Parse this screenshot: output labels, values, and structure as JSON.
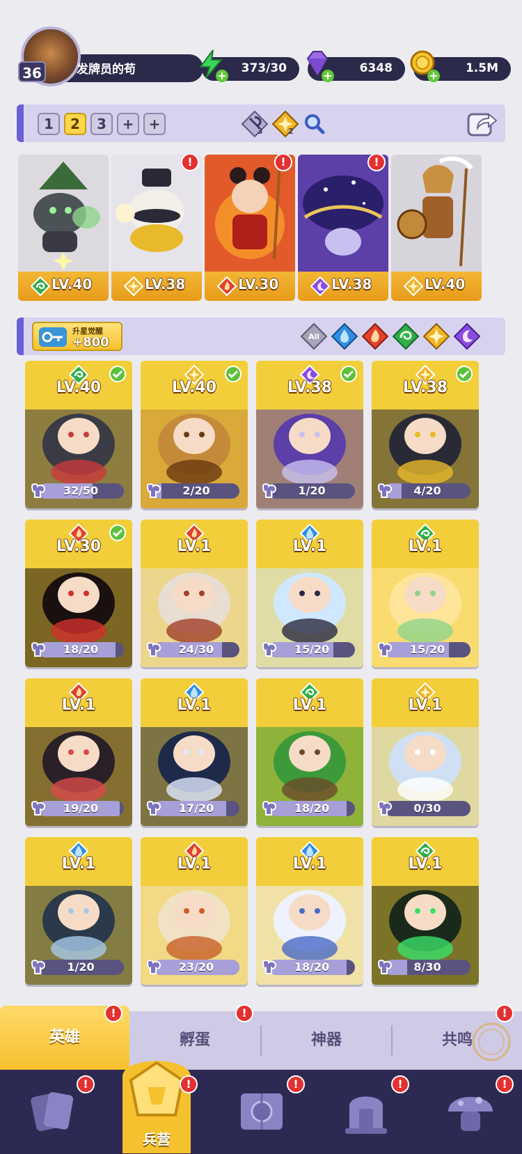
{
  "player": {
    "level": "36",
    "name": "发牌员的苟"
  },
  "resources": [
    {
      "icon": "energy-bolt-icon",
      "value": "373/30"
    },
    {
      "icon": "purple-gem-icon",
      "value": "6348"
    },
    {
      "icon": "gold-coin-icon",
      "value": "1.5M"
    }
  ],
  "team_bar": {
    "slots": [
      "1",
      "2",
      "3",
      "+",
      "+"
    ],
    "active_slot": "2",
    "icon_counts": [
      "3",
      "2"
    ]
  },
  "team_heroes": [
    {
      "level": "LV.40",
      "element": "nature",
      "badge": ""
    },
    {
      "level": "LV.38",
      "element": "light",
      "badge": "!"
    },
    {
      "level": "LV.30",
      "element": "fire",
      "badge": "!"
    },
    {
      "level": "LV.38",
      "element": "dark",
      "badge": "!"
    },
    {
      "level": "LV.40",
      "element": "light",
      "badge": ""
    }
  ],
  "filter_bar": {
    "awaken_label": "升星觉醒",
    "awaken_value": "+800",
    "filters": [
      "All",
      "water",
      "fire",
      "nature",
      "light",
      "dark"
    ]
  },
  "heroes": [
    {
      "level": "LV.40",
      "element": "nature",
      "progress": "32/50",
      "fill": 0.64,
      "check": true
    },
    {
      "level": "LV.40",
      "element": "light",
      "progress": "2/20",
      "fill": 0.1,
      "check": true
    },
    {
      "level": "LV.38",
      "element": "dark",
      "progress": "1/20",
      "fill": 0.05,
      "check": true
    },
    {
      "level": "LV.38",
      "element": "light",
      "progress": "4/20",
      "fill": 0.2,
      "check": true
    },
    {
      "level": "LV.30",
      "element": "fire",
      "progress": "18/20",
      "fill": 0.9,
      "check": true
    },
    {
      "level": "LV.1",
      "element": "fire",
      "progress": "24/30",
      "fill": 0.8,
      "check": false
    },
    {
      "level": "LV.1",
      "element": "water",
      "progress": "15/20",
      "fill": 0.75,
      "check": false
    },
    {
      "level": "LV.1",
      "element": "nature",
      "progress": "15/20",
      "fill": 0.75,
      "check": false
    },
    {
      "level": "LV.1",
      "element": "fire",
      "progress": "19/20",
      "fill": 0.95,
      "check": false
    },
    {
      "level": "LV.1",
      "element": "water",
      "progress": "17/20",
      "fill": 0.85,
      "check": false
    },
    {
      "level": "LV.1",
      "element": "nature",
      "progress": "18/20",
      "fill": 0.9,
      "check": false
    },
    {
      "level": "LV.1",
      "element": "light",
      "progress": "0/30",
      "fill": 0.0,
      "check": false
    },
    {
      "level": "LV.1",
      "element": "water",
      "progress": "1/20",
      "fill": 0.05,
      "check": false
    },
    {
      "level": "LV.1",
      "element": "fire",
      "progress": "23/20",
      "fill": 1.0,
      "check": false
    },
    {
      "level": "LV.1",
      "element": "water",
      "progress": "18/20",
      "fill": 0.9,
      "check": false
    },
    {
      "level": "LV.1",
      "element": "nature",
      "progress": "8/30",
      "fill": 0.27,
      "check": false
    }
  ],
  "tabs": [
    {
      "label": "英雄",
      "active": true,
      "badge": "!"
    },
    {
      "label": "孵蛋",
      "active": false,
      "badge": "!"
    },
    {
      "label": "神器",
      "active": false,
      "badge": ""
    },
    {
      "label": "共鸣",
      "active": false,
      "badge": "!"
    }
  ],
  "bottom_nav": [
    {
      "icon": "cards-icon",
      "label": "",
      "badge": "!"
    },
    {
      "icon": "barracks-icon",
      "label": "兵营",
      "badge": "!",
      "active": true
    },
    {
      "icon": "map-icon",
      "label": "",
      "badge": "!"
    },
    {
      "icon": "shrine-icon",
      "label": "",
      "badge": "!"
    },
    {
      "icon": "mushroom-house-icon",
      "label": "",
      "badge": "!"
    }
  ],
  "colors": {
    "fire": "#e4402a",
    "water": "#2f8ee0",
    "nature": "#2fae4a",
    "light": "#f1b42a",
    "dark": "#8a4be0"
  }
}
